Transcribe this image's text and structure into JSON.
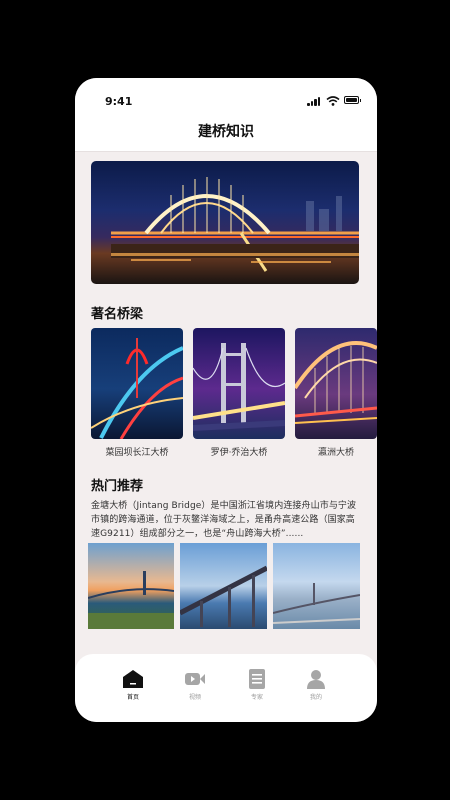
{
  "status_bar": {
    "time": "9:41"
  },
  "header": {
    "title": "建桥知识"
  },
  "famous": {
    "title": "著名桥梁",
    "items": [
      {
        "label": "菜园坝长江大桥"
      },
      {
        "label": "罗伊·乔治大桥"
      },
      {
        "label": "瀛洲大桥"
      }
    ]
  },
  "hot": {
    "title": "热门推荐",
    "description": "金塘大桥（Jintang Bridge）是中国浙江省境内连接舟山市与宁波市镇的跨海通道，位于灰鳖洋海域之上，是甬舟高速公路（国家高速G9211）组成部分之一，也是“舟山跨海大桥”......"
  },
  "nav": {
    "items": [
      {
        "label": "首页",
        "icon": "home-icon",
        "active": true
      },
      {
        "label": "视频",
        "icon": "video-icon",
        "active": false
      },
      {
        "label": "专家",
        "icon": "document-icon",
        "active": false
      },
      {
        "label": "我的",
        "icon": "profile-icon",
        "active": false
      }
    ]
  }
}
